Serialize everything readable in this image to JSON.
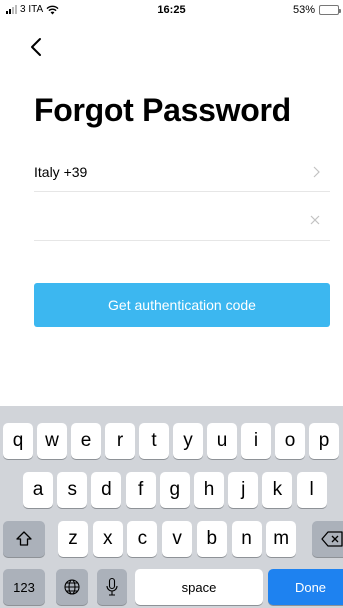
{
  "status_bar": {
    "carrier": "3 ITA",
    "time": "16:25",
    "battery": "53%",
    "battery_level": 0.53
  },
  "header": {
    "back_icon": "chevron-left-icon",
    "title": "Forgot Password"
  },
  "form": {
    "country_label": "Italy +39",
    "country_icon": "chevron-right-icon",
    "phone_value": "",
    "phone_placeholder": "",
    "clear_icon": "clear-x-icon",
    "submit_label": "Get authentication code"
  },
  "colors": {
    "button": "#3cb7f0",
    "keyboard_bg": "#d1d4d9",
    "done_key": "#1e82f0",
    "battery": "#4cd964"
  },
  "keyboard": {
    "row1": [
      "q",
      "w",
      "e",
      "r",
      "t",
      "y",
      "u",
      "i",
      "o",
      "p"
    ],
    "row2": [
      "a",
      "s",
      "d",
      "f",
      "g",
      "h",
      "j",
      "k",
      "l"
    ],
    "row3": [
      "z",
      "x",
      "c",
      "v",
      "b",
      "n",
      "m"
    ],
    "numbers_label": "123",
    "space_label": "space",
    "done_label": "Done",
    "icons": [
      "shift-icon",
      "backspace-icon",
      "globe-icon",
      "microphone-icon"
    ]
  }
}
